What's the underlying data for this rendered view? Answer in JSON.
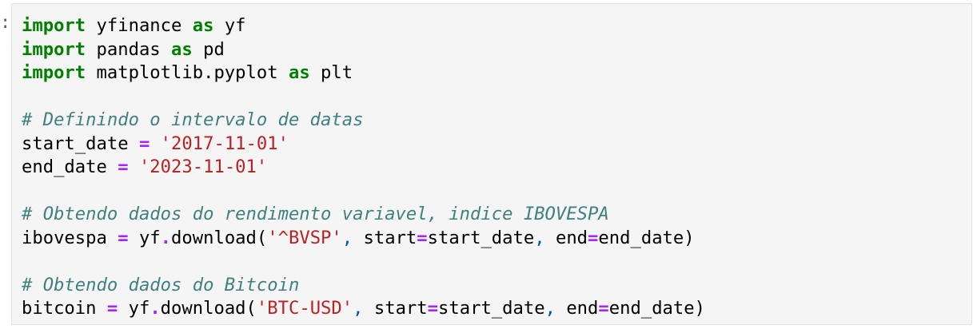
{
  "cell": {
    "prompt_marker": ":",
    "lines": [
      [
        {
          "t": "import",
          "c": "kw"
        },
        {
          "t": " yfinance ",
          "c": ""
        },
        {
          "t": "as",
          "c": "kw"
        },
        {
          "t": " yf",
          "c": ""
        }
      ],
      [
        {
          "t": "import",
          "c": "kw"
        },
        {
          "t": " pandas ",
          "c": ""
        },
        {
          "t": "as",
          "c": "kw"
        },
        {
          "t": " pd",
          "c": ""
        }
      ],
      [
        {
          "t": "import",
          "c": "kw"
        },
        {
          "t": " matplotlib.pyplot ",
          "c": ""
        },
        {
          "t": "as",
          "c": "kw"
        },
        {
          "t": " plt",
          "c": ""
        }
      ],
      [],
      [
        {
          "t": "# Definindo o intervalo de datas",
          "c": "cm"
        }
      ],
      [
        {
          "t": "start_date ",
          "c": ""
        },
        {
          "t": "=",
          "c": "op"
        },
        {
          "t": " ",
          "c": ""
        },
        {
          "t": "'2017-11-01'",
          "c": "st"
        }
      ],
      [
        {
          "t": "end_date ",
          "c": ""
        },
        {
          "t": "=",
          "c": "op"
        },
        {
          "t": " ",
          "c": ""
        },
        {
          "t": "'2023-11-01'",
          "c": "st"
        }
      ],
      [],
      [
        {
          "t": "# Obtendo dados do rendimento variavel, indice IBOVESPA",
          "c": "cm"
        }
      ],
      [
        {
          "t": "ibovespa ",
          "c": ""
        },
        {
          "t": "=",
          "c": "op"
        },
        {
          "t": " yf",
          "c": ""
        },
        {
          "t": ".",
          "c": "op"
        },
        {
          "t": "download(",
          "c": ""
        },
        {
          "t": "'^BVSP'",
          "c": "st"
        },
        {
          "t": ",",
          "c": "pn"
        },
        {
          "t": " start",
          "c": ""
        },
        {
          "t": "=",
          "c": "op"
        },
        {
          "t": "start_date",
          "c": ""
        },
        {
          "t": ",",
          "c": "pn"
        },
        {
          "t": " end",
          "c": ""
        },
        {
          "t": "=",
          "c": "op"
        },
        {
          "t": "end_date)",
          "c": ""
        }
      ],
      [],
      [
        {
          "t": "# Obtendo dados do Bitcoin",
          "c": "cm"
        }
      ],
      [
        {
          "t": "bitcoin ",
          "c": ""
        },
        {
          "t": "=",
          "c": "op"
        },
        {
          "t": " yf",
          "c": ""
        },
        {
          "t": ".",
          "c": "op"
        },
        {
          "t": "download(",
          "c": ""
        },
        {
          "t": "'BTC-USD'",
          "c": "st"
        },
        {
          "t": ",",
          "c": "pn"
        },
        {
          "t": " start",
          "c": ""
        },
        {
          "t": "=",
          "c": "op"
        },
        {
          "t": "start_date",
          "c": ""
        },
        {
          "t": ",",
          "c": "pn"
        },
        {
          "t": " end",
          "c": ""
        },
        {
          "t": "=",
          "c": "op"
        },
        {
          "t": "end_date)",
          "c": ""
        }
      ]
    ]
  },
  "colors": {
    "keyword": "#008000",
    "comment": "#408080",
    "string": "#ba2121",
    "operator": "#aa22ff",
    "punctuation": "#0055aa",
    "cell_background": "#f5f5f5",
    "cell_border": "#e0e0e0"
  }
}
